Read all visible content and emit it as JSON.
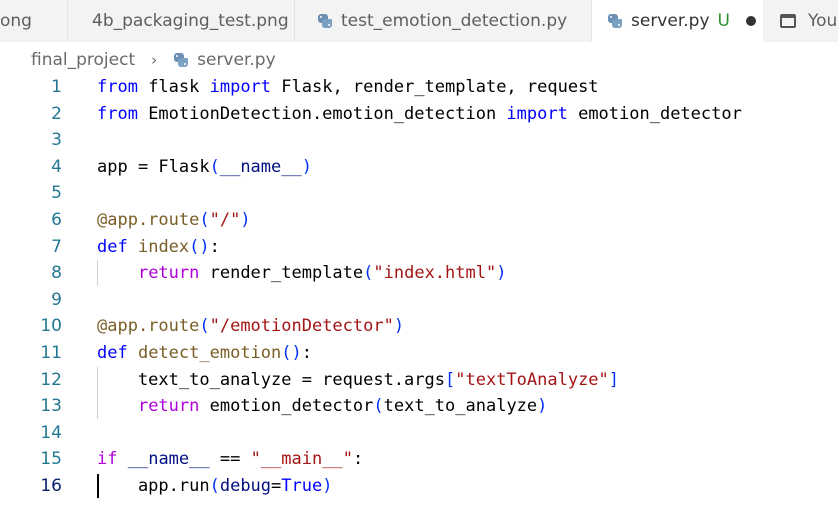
{
  "tabs": [
    {
      "label": "ong"
    },
    {
      "label": "4b_packaging_test.png"
    },
    {
      "label": "test_emotion_detection.py"
    },
    {
      "label": "server.py",
      "status": "U"
    },
    {
      "label": "You"
    }
  ],
  "breadcrumb": {
    "folder": "final_project",
    "separator": "›",
    "file": "server.py"
  },
  "editor": {
    "active_line": 16,
    "lines": [
      {
        "n": "1",
        "tokens": [
          [
            "kw",
            "from"
          ],
          [
            "plain",
            " flask "
          ],
          [
            "kw",
            "import"
          ],
          [
            "plain",
            " Flask, render_template, request"
          ]
        ]
      },
      {
        "n": "2",
        "tokens": [
          [
            "kw",
            "from"
          ],
          [
            "plain",
            " EmotionDetection.emotion_detection "
          ],
          [
            "kw",
            "import"
          ],
          [
            "plain",
            " emotion_detector"
          ]
        ]
      },
      {
        "n": "3",
        "tokens": []
      },
      {
        "n": "4",
        "tokens": [
          [
            "plain",
            "app = Flask"
          ],
          [
            "b1",
            "("
          ],
          [
            "var",
            "__name__"
          ],
          [
            "b1",
            ")"
          ]
        ]
      },
      {
        "n": "5",
        "tokens": []
      },
      {
        "n": "6",
        "tokens": [
          [
            "fn",
            "@app.route"
          ],
          [
            "b1",
            "("
          ],
          [
            "str",
            "\"/\""
          ],
          [
            "b1",
            ")"
          ]
        ]
      },
      {
        "n": "7",
        "tokens": [
          [
            "kw",
            "def"
          ],
          [
            "plain",
            " "
          ],
          [
            "fn",
            "index"
          ],
          [
            "b1",
            "()"
          ],
          [
            "plain",
            ":"
          ]
        ]
      },
      {
        "n": "8",
        "guide": true,
        "tokens": [
          [
            "plain",
            "    "
          ],
          [
            "ctl",
            "return"
          ],
          [
            "plain",
            " render_template"
          ],
          [
            "b1",
            "("
          ],
          [
            "str",
            "\"index.html\""
          ],
          [
            "b1",
            ")"
          ]
        ]
      },
      {
        "n": "9",
        "tokens": []
      },
      {
        "n": "10",
        "tokens": [
          [
            "fn",
            "@app.route"
          ],
          [
            "b1",
            "("
          ],
          [
            "str",
            "\"/emotionDetector\""
          ],
          [
            "b1",
            ")"
          ]
        ]
      },
      {
        "n": "11",
        "tokens": [
          [
            "kw",
            "def"
          ],
          [
            "plain",
            " "
          ],
          [
            "fn",
            "detect_emotion"
          ],
          [
            "b1",
            "()"
          ],
          [
            "plain",
            ":"
          ]
        ]
      },
      {
        "n": "12",
        "guide": true,
        "tokens": [
          [
            "plain",
            "    text_to_analyze = request.args"
          ],
          [
            "b1",
            "["
          ],
          [
            "str",
            "\"textToAnalyze\""
          ],
          [
            "b1",
            "]"
          ]
        ]
      },
      {
        "n": "13",
        "guide": true,
        "tokens": [
          [
            "plain",
            "    "
          ],
          [
            "ctl",
            "return"
          ],
          [
            "plain",
            " emotion_detector"
          ],
          [
            "b1",
            "("
          ],
          [
            "plain",
            "text_to_analyze"
          ],
          [
            "b1",
            ")"
          ]
        ]
      },
      {
        "n": "14",
        "tokens": []
      },
      {
        "n": "15",
        "tokens": [
          [
            "ctl",
            "if"
          ],
          [
            "plain",
            " "
          ],
          [
            "var",
            "__name__"
          ],
          [
            "plain",
            " == "
          ],
          [
            "str",
            "\"__main__\""
          ],
          [
            "plain",
            ":"
          ]
        ]
      },
      {
        "n": "16",
        "guide": true,
        "cursor": true,
        "tokens": [
          [
            "plain",
            "    app.run"
          ],
          [
            "b1",
            "("
          ],
          [
            "var",
            "debug"
          ],
          [
            "plain",
            "="
          ],
          [
            "kw",
            "True"
          ],
          [
            "b1",
            ")"
          ]
        ]
      }
    ]
  }
}
